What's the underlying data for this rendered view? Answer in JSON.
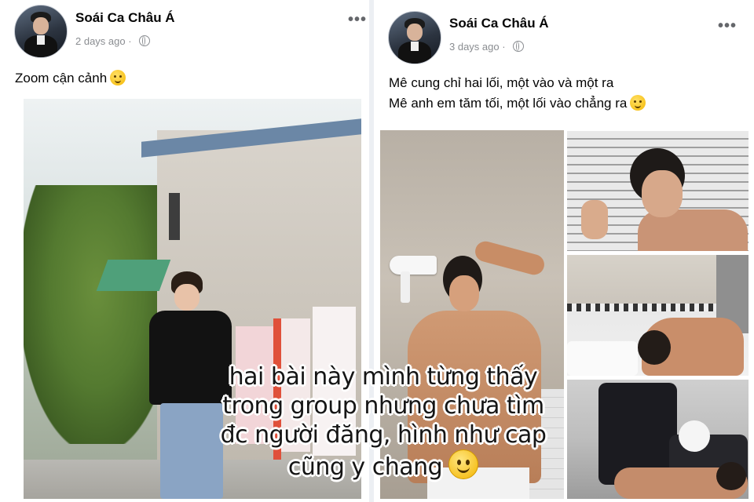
{
  "posts": [
    {
      "author": "Soái Ca Châu Á",
      "time": "2 days ago",
      "separator": "·",
      "privacy_icon": "globe-icon",
      "more_label": "•••",
      "caption": "Zoom cận cảnh",
      "caption_emoji": "drooling-face-emoji",
      "photos": [
        "street-portrait-photo"
      ]
    },
    {
      "author": "Soái Ca Châu Á",
      "time": "3 days ago",
      "separator": "·",
      "privacy_icon": "globe-icon",
      "more_label": "•••",
      "caption_lines": [
        "Mê cung chỉ hai lối, một vào và một ra",
        "Mê anh em tăm tối, một lối vào chẳng ra"
      ],
      "caption_emoji": "tongue-out-face-emoji",
      "photos": [
        "hair-dryer-photo",
        "window-blinds-photo",
        "bathroom-photo",
        "bed-photo"
      ]
    }
  ],
  "overlay": {
    "lines": [
      "hai bài này mình từng thấy",
      "trong group nhưng chưa tìm",
      "đc người đăng, hình như cap",
      "cũng y chang"
    ],
    "emoji": "slightly-smiling-face-emoji"
  },
  "colors": {
    "name": "#050505",
    "meta": "#8a8d91",
    "divider": "#eceff3",
    "overlay_text": "#151515"
  }
}
